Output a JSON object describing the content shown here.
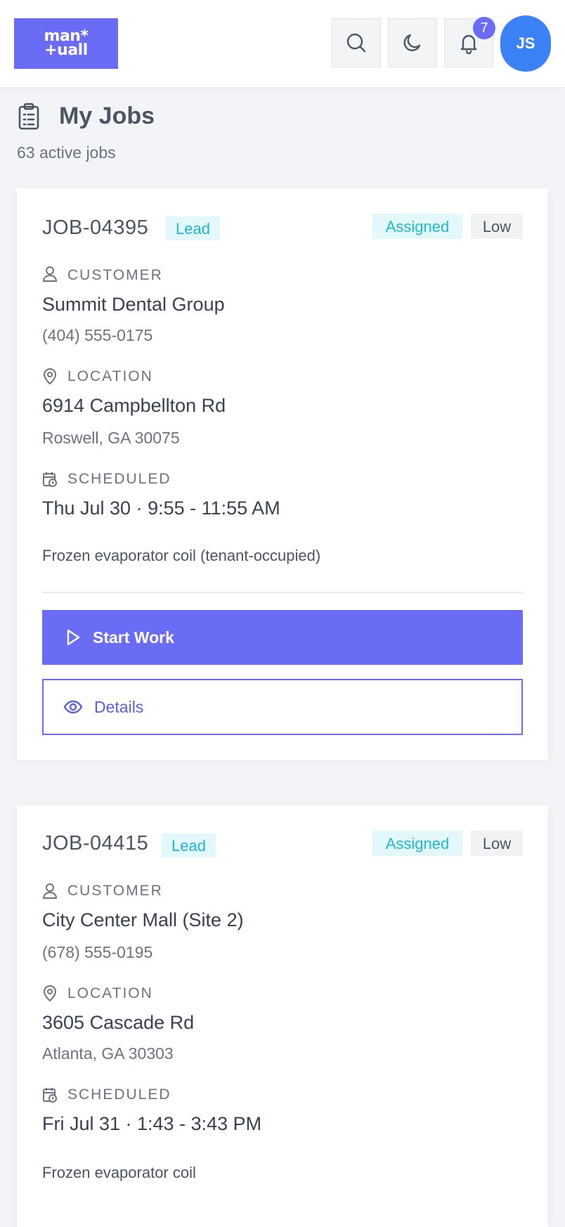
{
  "header": {
    "logo_line1": "man*",
    "logo_line2": "+uall",
    "notifications_count": "7",
    "avatar_initials": "JS",
    "icons": [
      "search-icon",
      "moon-icon",
      "bell-icon"
    ]
  },
  "page": {
    "title": "My Jobs",
    "subtitle": "63 active jobs"
  },
  "labels": {
    "customer": "CUSTOMER",
    "location": "LOCATION",
    "scheduled": "SCHEDULED",
    "start_work": "Start Work",
    "details": "Details"
  },
  "jobs": [
    {
      "id": "JOB-04395",
      "type": "Lead",
      "status": "Assigned",
      "priority": "Low",
      "customer_name": "Summit Dental Group",
      "customer_phone": "(404) 555-0175",
      "address_line1": "6914 Campbellton Rd",
      "address_line2": "Roswell, GA 30075",
      "scheduled": "Thu Jul 30 · 9:55 - 11:55 AM",
      "description": "Frozen evaporator coil (tenant-occupied)"
    },
    {
      "id": "JOB-04415",
      "type": "Lead",
      "status": "Assigned",
      "priority": "Low",
      "customer_name": "City Center Mall (Site 2)",
      "customer_phone": "(678) 555-0195",
      "address_line1": "3605 Cascade Rd",
      "address_line2": "Atlanta, GA 30303",
      "scheduled": "Fri Jul 31 · 1:43 - 3:43 PM",
      "description": "Frozen evaporator coil"
    }
  ],
  "colors": {
    "accent": "#6a6cf6",
    "avatar": "#3b82f6",
    "tag_bg": "#e3f8fb",
    "tag_text": "#20b8d2"
  }
}
